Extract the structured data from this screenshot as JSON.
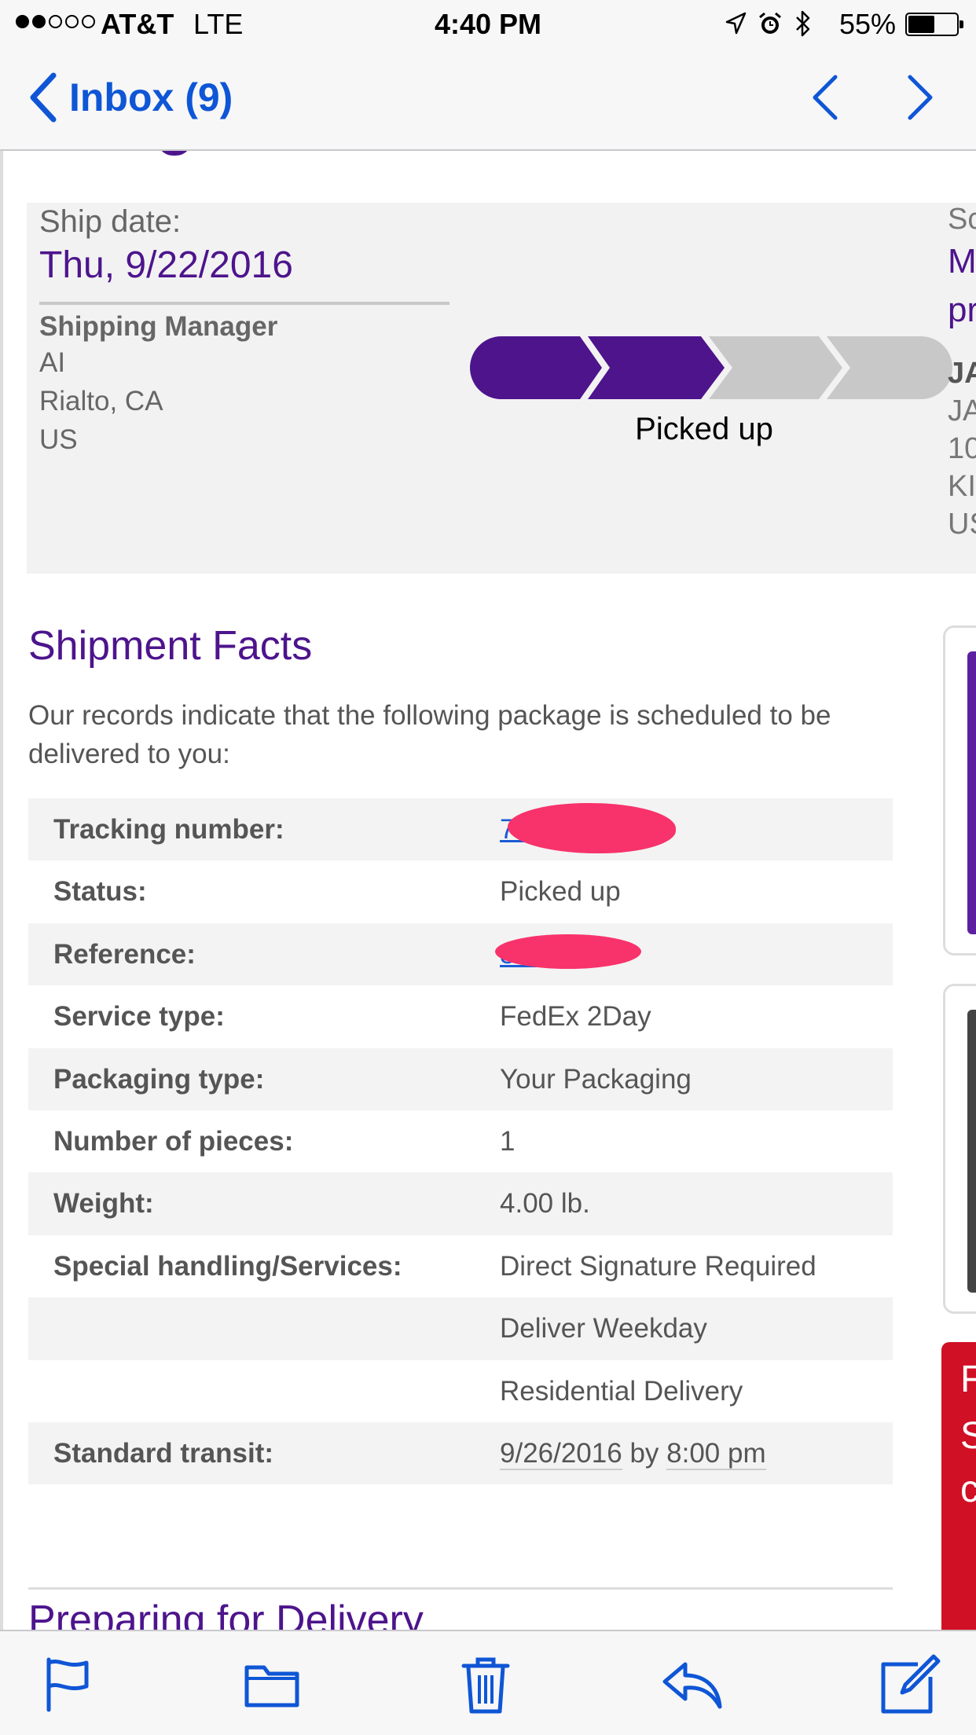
{
  "status_bar": {
    "carrier": "AT&T",
    "network": "LTE",
    "time": "4:40 PM",
    "battery_percent": "55%",
    "signal_bars_filled": 2,
    "signal_bars_total": 5,
    "battery_level": 0.55
  },
  "nav": {
    "back_label": "Inbox (9)",
    "accent_color": "#0f56d6"
  },
  "shipment": {
    "ship_date_label": "Ship date:",
    "ship_date": "Thu, 9/22/2016",
    "shipper": {
      "name": "Shipping Manager",
      "lines": [
        "AI",
        "Rialto, CA",
        "US"
      ]
    },
    "progress": {
      "steps_total": 4,
      "steps_completed": 2,
      "status_label": "Picked up"
    },
    "recipient_peek": {
      "label_fragment": "Sc",
      "value_fragments": [
        "M",
        "pr"
      ],
      "name_fragment": "JA",
      "lines": [
        "JA",
        "10",
        "KI",
        "US"
      ]
    }
  },
  "facts": {
    "title": "Shipment Facts",
    "intro": "Our records indicate that the following package is scheduled to be delivered to you:",
    "rows": [
      {
        "label": "Tracking number:",
        "value": "7…6",
        "link": true,
        "redacted": true
      },
      {
        "label": "Status:",
        "value": "Picked up"
      },
      {
        "label": "Reference:",
        "value": "8…17",
        "link": true,
        "redacted": true
      },
      {
        "label": "Service type:",
        "value": "FedEx 2Day"
      },
      {
        "label": "Packaging type:",
        "value": "Your Packaging"
      },
      {
        "label": "Number of pieces:",
        "value": "1"
      },
      {
        "label": "Weight:",
        "value": "4.00 lb."
      },
      {
        "label": "Special handling/Services:",
        "value": "Direct Signature Required"
      },
      {
        "label": "",
        "value": "Deliver Weekday"
      },
      {
        "label": "",
        "value": "Residential Delivery"
      }
    ],
    "transit": {
      "label": "Standard transit:",
      "date": "9/26/2016",
      "by": "by",
      "time": "8:00 pm"
    }
  },
  "side_ad_fragments": [
    "F",
    "S",
    "c"
  ],
  "next_section_title": "Preparing for Delivery",
  "toolbar": {
    "icons": [
      "flag-icon",
      "folder-icon",
      "trash-icon",
      "reply-icon",
      "compose-icon"
    ]
  },
  "colors": {
    "fedex_purple": "#4d148c",
    "ios_blue": "#0f56d6",
    "redaction": "#f8326b",
    "progress_pending": "#c8c8c8"
  }
}
